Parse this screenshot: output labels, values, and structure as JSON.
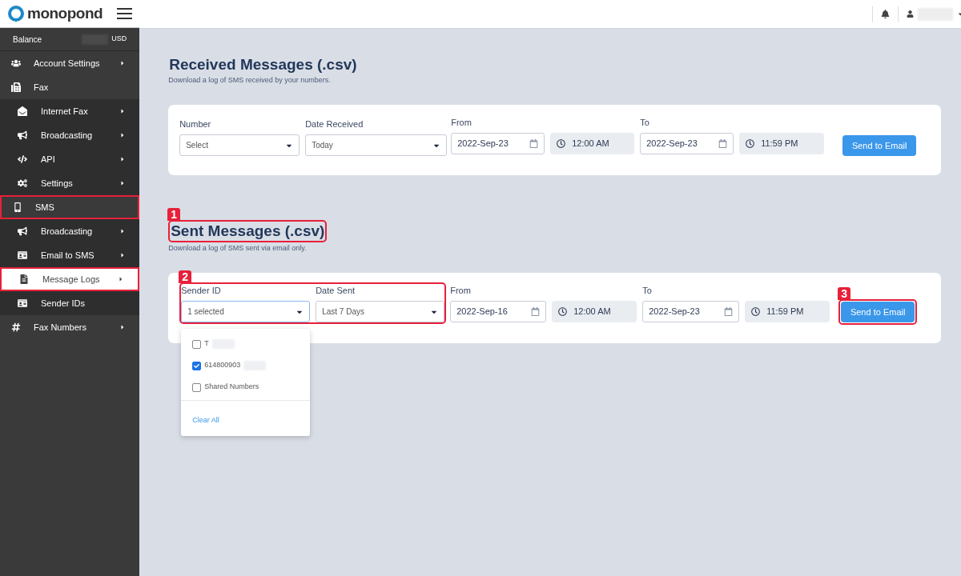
{
  "brand": {
    "name": "monopond"
  },
  "balance": {
    "label": "Balance",
    "currency": "USD"
  },
  "sidebar": {
    "items": [
      {
        "kind": "top",
        "label": "Account Settings",
        "submenu": true,
        "selected": false,
        "outlined": false
      },
      {
        "kind": "top",
        "label": "Fax",
        "submenu": false,
        "selected": false,
        "outlined": false
      },
      {
        "kind": "sub",
        "label": "Internet Fax",
        "submenu": true,
        "selected": false,
        "outlined": false
      },
      {
        "kind": "sub",
        "label": "Broadcasting",
        "submenu": true,
        "selected": false,
        "outlined": false
      },
      {
        "kind": "sub",
        "label": "API",
        "submenu": true,
        "selected": false,
        "outlined": false
      },
      {
        "kind": "sub",
        "label": "Settings",
        "submenu": true,
        "selected": false,
        "outlined": false
      },
      {
        "kind": "top",
        "label": "SMS",
        "submenu": false,
        "selected": false,
        "outlined": true
      },
      {
        "kind": "sub",
        "label": "Broadcasting",
        "submenu": true,
        "selected": false,
        "outlined": false
      },
      {
        "kind": "sub",
        "label": "Email to SMS",
        "submenu": true,
        "selected": false,
        "outlined": false
      },
      {
        "kind": "sub",
        "label": "Message Logs",
        "submenu": true,
        "selected": true,
        "outlined": true
      },
      {
        "kind": "sub",
        "label": "Sender IDs",
        "submenu": false,
        "selected": false,
        "outlined": false
      },
      {
        "kind": "top",
        "label": "Fax Numbers",
        "submenu": true,
        "selected": false,
        "outlined": false
      }
    ]
  },
  "sections": [
    {
      "title": "Received Messages (.csv)",
      "subtitle": "Download a log of SMS received by your numbers.",
      "fields": [
        {
          "kind": "select",
          "label": "Number",
          "value": "Select",
          "focused": false
        },
        {
          "kind": "select",
          "label": "Date Received",
          "value": "Today",
          "focused": false
        },
        {
          "kind": "date",
          "label": "From",
          "value": "2022-Sep-23"
        },
        {
          "kind": "time",
          "value": "12:00 AM"
        },
        {
          "kind": "date",
          "label": "To",
          "value": "2022-Sep-23"
        },
        {
          "kind": "time",
          "value": "11:59 PM"
        }
      ],
      "button": "Send to Email"
    },
    {
      "title": "Sent Messages (.csv)",
      "subtitle": "Download a log of SMS sent via email only.",
      "title_callout": "1",
      "fields_callout": "2",
      "button_callout": "3",
      "fields": [
        {
          "kind": "select",
          "label": "Sender ID",
          "value": "1 selected",
          "focused": true
        },
        {
          "kind": "select",
          "label": "Date Sent",
          "value": "Last 7 Days",
          "focused": false
        },
        {
          "kind": "date",
          "label": "From",
          "value": "2022-Sep-16"
        },
        {
          "kind": "time",
          "value": "12:00 AM"
        },
        {
          "kind": "date",
          "label": "To",
          "value": "2022-Sep-23"
        },
        {
          "kind": "time",
          "value": "11:59 PM"
        }
      ],
      "button": "Send to Email",
      "dropdown": {
        "options": [
          {
            "label": "T",
            "checked": false,
            "redacted": true
          },
          {
            "label": "614800903",
            "checked": true,
            "redacted": true
          },
          {
            "label": "Shared Numbers",
            "checked": false,
            "redacted": false
          }
        ],
        "clear": "Clear All"
      }
    }
  ]
}
